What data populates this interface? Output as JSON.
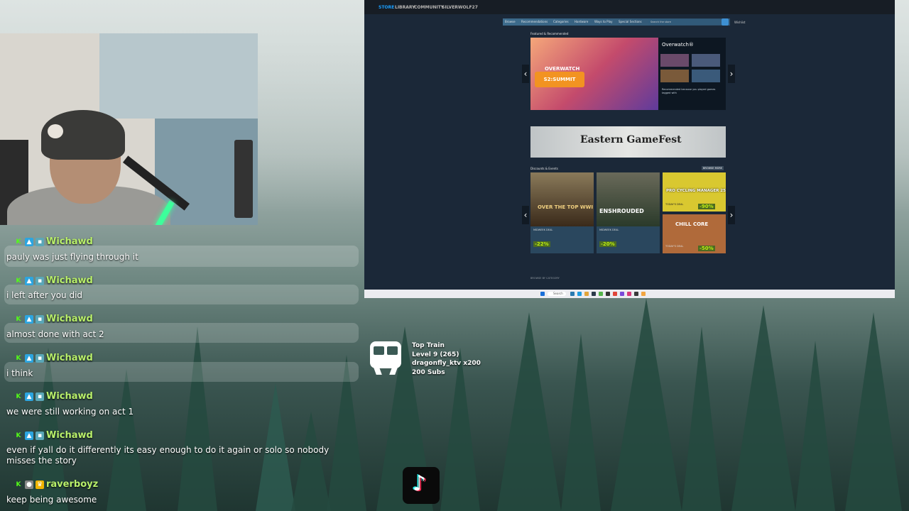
{
  "chat": {
    "messages": [
      {
        "user": "Wichawd",
        "badges": [
          "K",
          "tw",
          "sub"
        ],
        "text": "pauly was just flying through it"
      },
      {
        "user": "Wichawd",
        "badges": [
          "K",
          "tw",
          "sub"
        ],
        "text": "i left after you did"
      },
      {
        "user": "Wichawd",
        "badges": [
          "K",
          "tw",
          "sub"
        ],
        "text": "almost done with act 2"
      },
      {
        "user": "Wichawd",
        "badges": [
          "K",
          "tw",
          "sub"
        ],
        "text": "i think"
      },
      {
        "user": "Wichawd",
        "badges": [
          "K",
          "tw",
          "sub"
        ],
        "text": "we were still working on act 1"
      },
      {
        "user": "Wichawd",
        "badges": [
          "K",
          "tw",
          "sub"
        ],
        "text": "even if yall do it differently its easy enough to do it again or solo so nobody misses the story"
      },
      {
        "user": "raverboyz",
        "badges": [
          "K",
          "gr",
          "crown"
        ],
        "text": "keep being awesome"
      }
    ]
  },
  "steam": {
    "nav": [
      "STORE",
      "LIBRARY",
      "COMMUNITY",
      "SILVERWOLF27"
    ],
    "subnav": [
      "Browse",
      "Recommendations",
      "Categories",
      "Hardware",
      "Ways to Play",
      "Special Sections"
    ],
    "search_placeholder": "Search the store",
    "wishlist": "Wishlist",
    "featured_heading": "Featured & Recommended",
    "featured_title": "Overwatch®",
    "featured_logo": "OVERWATCH",
    "featured_event": "S2:SUMMIT",
    "featured_reason": "Recommended because you played games tagged with",
    "banner_title": "Eastern GameFest",
    "discounts_heading": "Discounts & Events",
    "browse_more": "BROWSE MORE",
    "browse_category": "BROWSE BY CATEGORY",
    "cards": [
      {
        "title": "OVER THE TOP WWI",
        "label": "MIDWEEK DEAL",
        "discount": "-22%"
      },
      {
        "title": "ENSHROUDED",
        "label": "MIDWEEK DEAL",
        "discount": "-20%"
      },
      {
        "title": "PRO CYCLING MANAGER 25",
        "label": "TODAY'S DEAL",
        "discount": "-90%"
      },
      {
        "title": "CHILL CORE",
        "label": "TODAY'S DEAL",
        "discount": "-50%"
      }
    ]
  },
  "overlay": {
    "train_title": "Top Train",
    "train_level": "Level 9 (265)",
    "train_top": "dragonfly_ktv x200",
    "train_subs": "200 Subs"
  },
  "taskbar": {
    "search": "Search"
  },
  "colors": {
    "username": "#b9f06b",
    "kick": "#53fc18",
    "steam_bg": "#1b2838",
    "steam_accent": "#1a9fff"
  }
}
